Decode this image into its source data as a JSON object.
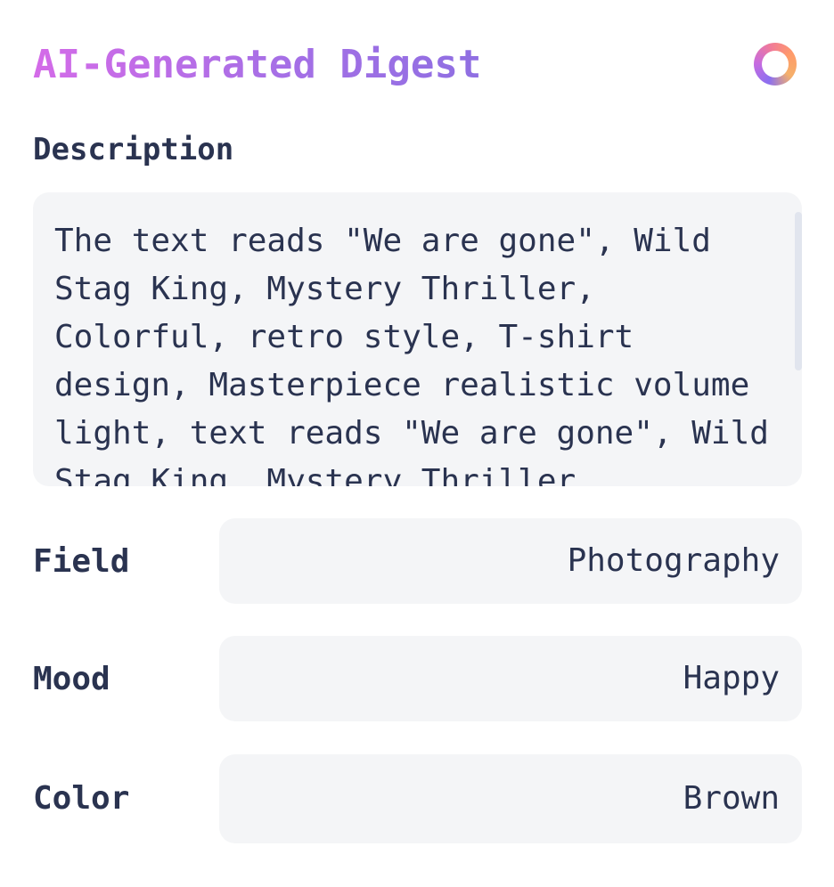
{
  "header": {
    "title": "AI-Generated Digest",
    "status_icon": "loading-ring-icon"
  },
  "description": {
    "label": "Description",
    "text": "The text reads \"We are gone\", Wild Stag King, Mystery Thriller, Colorful, retro style, T-shirt design, Masterpiece realistic volume light, text reads \"We are gone\", Wild Stag King, Mystery Thriller, Colorful, retro style, T-shirt design"
  },
  "attributes": [
    {
      "label": "Field",
      "value": "Photography"
    },
    {
      "label": "Mood",
      "value": "Happy"
    },
    {
      "label": "Color",
      "value": "Brown"
    }
  ],
  "colors": {
    "title_gradient_start": "#d46be8",
    "title_gradient_end": "#8f6fe2",
    "text": "#2a3350",
    "field_background": "#f4f5f7"
  }
}
